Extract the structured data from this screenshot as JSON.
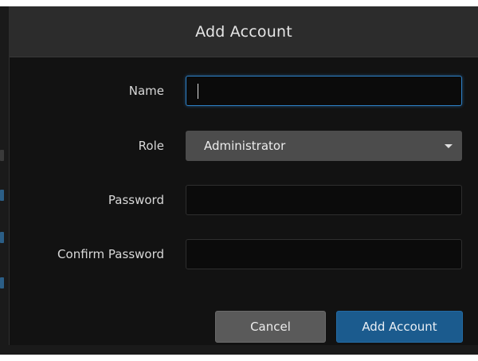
{
  "dialog": {
    "title": "Add Account",
    "fields": {
      "name": {
        "label": "Name",
        "value": ""
      },
      "role": {
        "label": "Role",
        "value": "Administrator"
      },
      "password": {
        "label": "Password",
        "value": ""
      },
      "confirm_password": {
        "label": "Confirm Password",
        "value": ""
      }
    },
    "buttons": {
      "cancel": "Cancel",
      "submit": "Add Account"
    }
  },
  "icons": {
    "role_dropdown": "chevron-down-icon"
  },
  "colors": {
    "primary_button": "#1b5b8e",
    "focus_border": "#2d7fc4",
    "dialog_background": "#121212",
    "header_background": "#2c2c2c"
  }
}
